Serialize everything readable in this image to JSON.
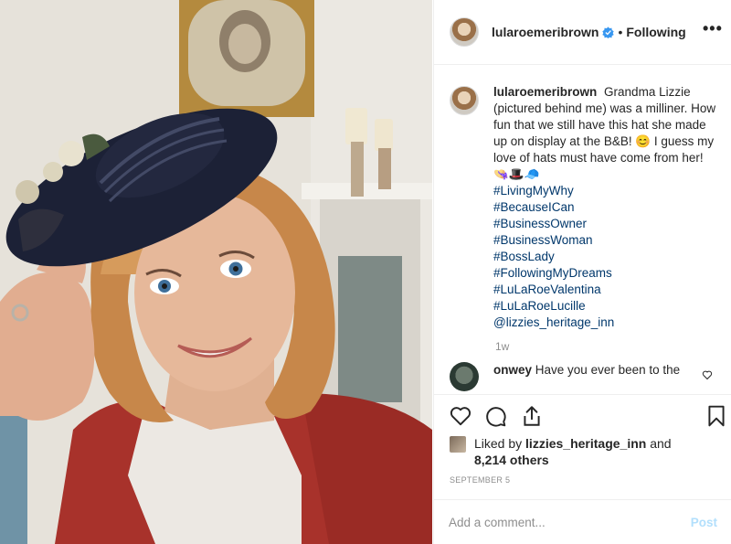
{
  "post": {
    "photo_alt": "",
    "author": "lularoemeribrown",
    "follow_status": "Following",
    "separator": "•",
    "more_label": "•••"
  },
  "caption": {
    "author": "lularoemeribrown",
    "text": "Grandma Lizzie (pictured behind me) was a milliner. How fun that we still have this hat she made up on display at the B&B! 😊 I guess my love of hats must have come from her! 👒🎩🧢",
    "tags": [
      "#LivingMyWhy",
      "#BecauseICan",
      "#BusinessOwner",
      "#BusinessWoman",
      "#BossLady",
      "#FollowingMyDreams",
      "#LuLaRoeValentina",
      "#LuLaRoeLucille",
      "@lizzies_heritage_inn"
    ],
    "time_ago": "1w"
  },
  "comments": [
    {
      "author": "onwey",
      "text": "Have you ever been to the"
    }
  ],
  "actions": {
    "like_icon": "heart-icon",
    "comment_icon": "comment-icon",
    "share_icon": "share-icon",
    "save_icon": "bookmark-icon"
  },
  "likes": {
    "prefix": "Liked by",
    "user": "lizzies_heritage_inn",
    "conj": "and",
    "others": "8,214 others"
  },
  "date": "SEPTEMBER 5",
  "add_comment": {
    "placeholder": "Add a comment...",
    "post_label": "Post"
  },
  "colors": {
    "verified": "#3897f0",
    "link": "#00376b",
    "muted": "#8e8e8e",
    "post_disabled": "#b2dffc"
  }
}
